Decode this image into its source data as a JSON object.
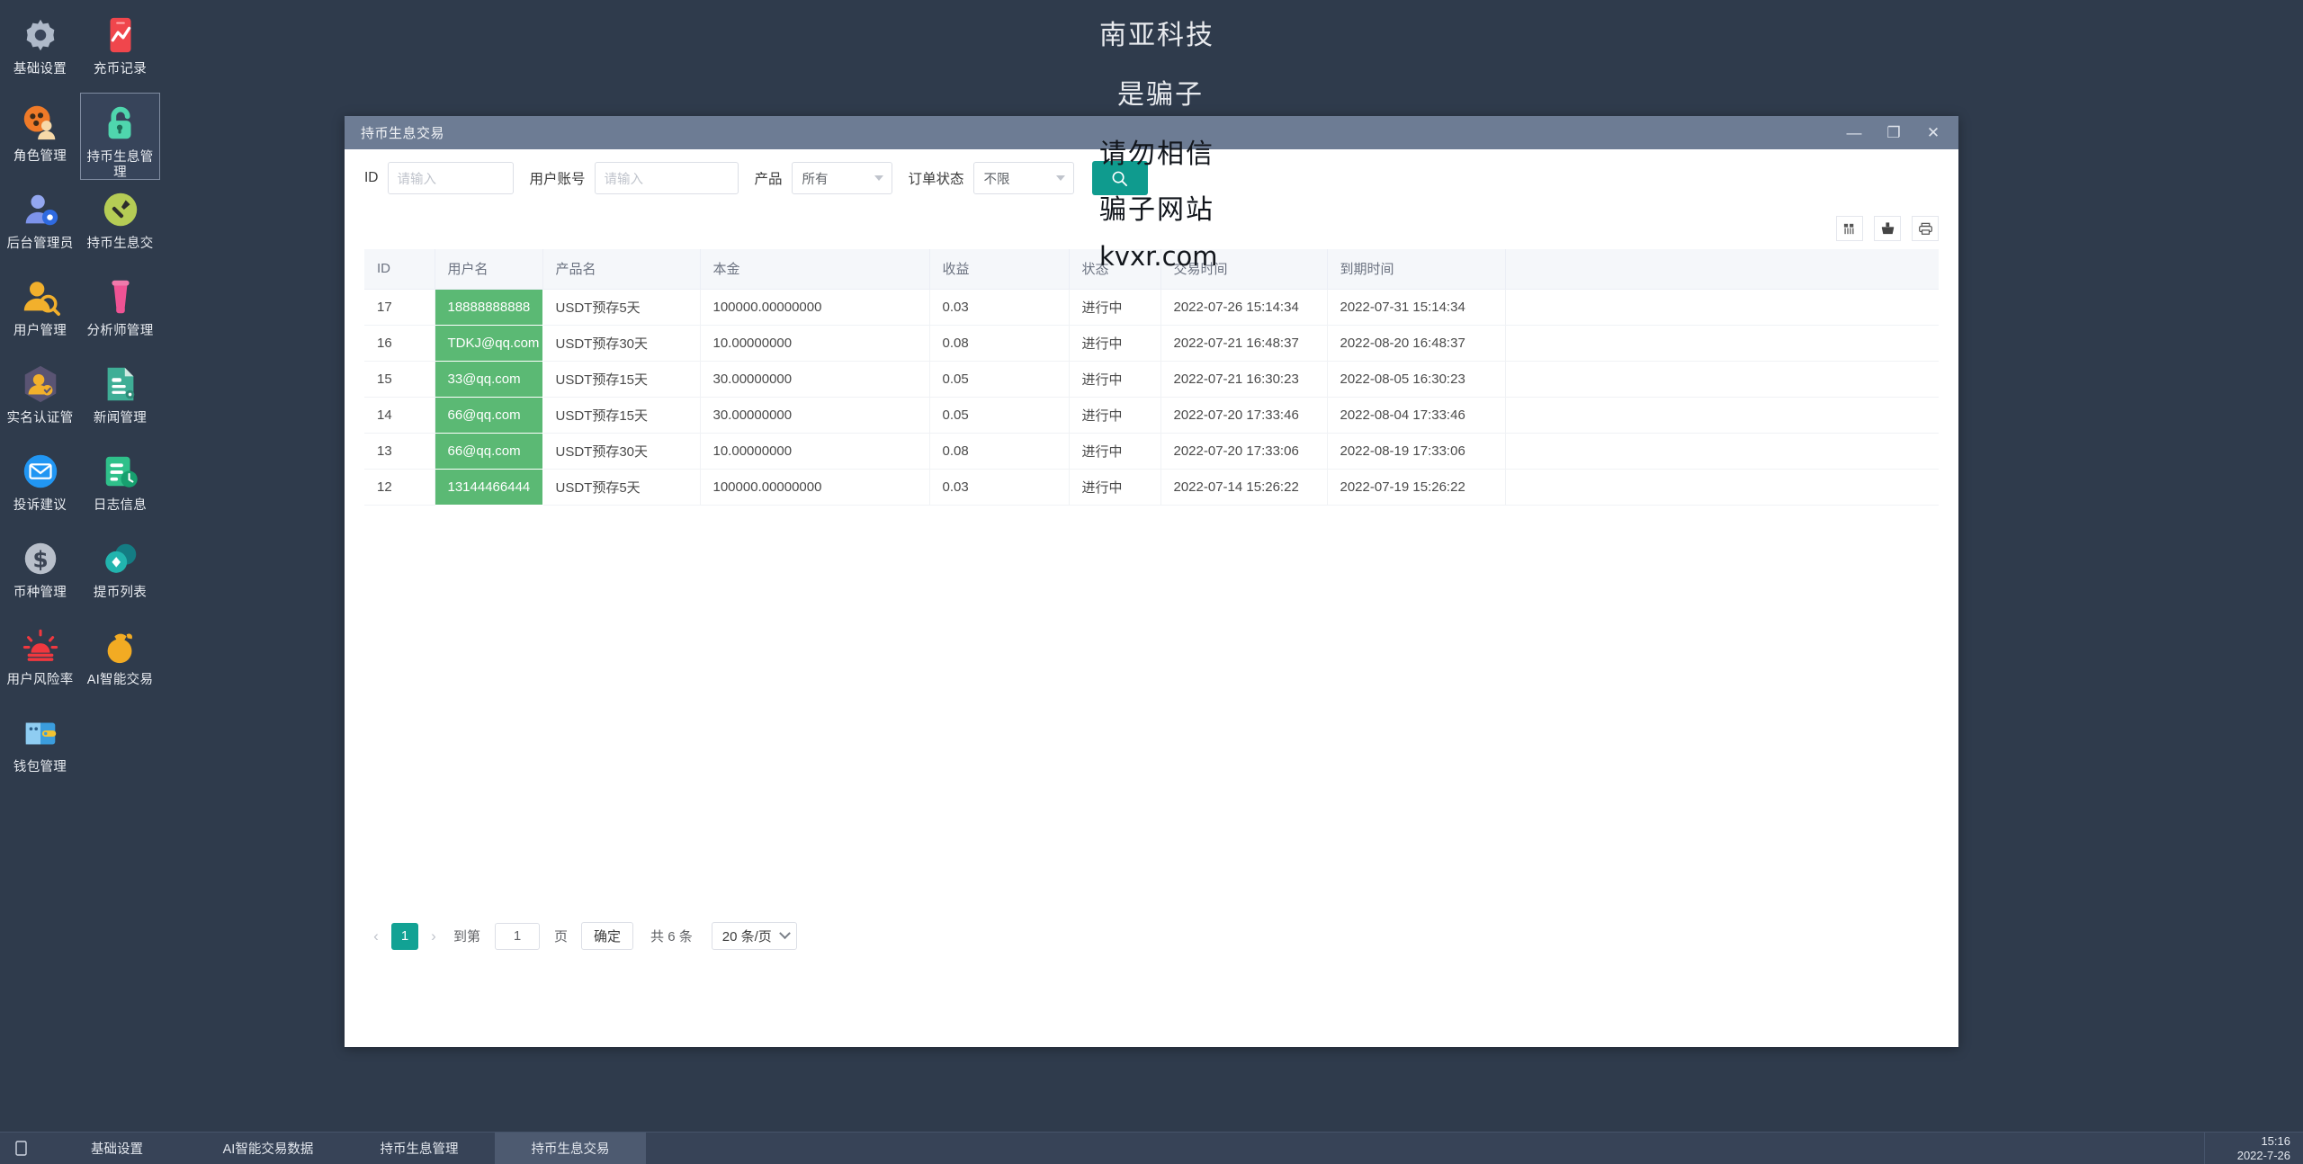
{
  "sidebar": {
    "items": [
      {
        "label": "基础设置",
        "icon": "gear-icon",
        "selected": false
      },
      {
        "label": "充币记录",
        "icon": "chart-card-icon",
        "selected": false
      },
      {
        "label": "角色管理",
        "icon": "role-user-icon",
        "selected": false
      },
      {
        "label": "持币生息管理",
        "icon": "lock-open-icon",
        "selected": true
      },
      {
        "label": "后台管理员",
        "icon": "user-gear-icon",
        "selected": false
      },
      {
        "label": "持币生息交",
        "icon": "hammer-icon",
        "selected": false
      },
      {
        "label": "用户管理",
        "icon": "user-search-icon",
        "selected": false
      },
      {
        "label": "分析师管理",
        "icon": "megaphone-icon",
        "selected": false
      },
      {
        "label": "实名认证管",
        "icon": "verified-user-icon",
        "selected": false
      },
      {
        "label": "新闻管理",
        "icon": "document-gear-icon",
        "selected": false
      },
      {
        "label": "投诉建议",
        "icon": "mail-icon",
        "selected": false
      },
      {
        "label": "日志信息",
        "icon": "log-clock-icon",
        "selected": false
      },
      {
        "label": "币种管理",
        "icon": "dollar-coin-icon",
        "selected": false
      },
      {
        "label": "提币列表",
        "icon": "coins-icon",
        "selected": false
      },
      {
        "label": "用户风险率",
        "icon": "alarm-icon",
        "selected": false
      },
      {
        "label": "AI智能交易",
        "icon": "money-bag-icon",
        "selected": false
      },
      {
        "label": "钱包管理",
        "icon": "wallet-icon",
        "selected": false
      }
    ]
  },
  "window": {
    "title": "持币生息交易",
    "minimize_label": "—",
    "maximize_label": "❐",
    "close_label": "✕"
  },
  "search": {
    "id_label": "ID",
    "id_placeholder": "请输入",
    "account_label": "用户账号",
    "account_placeholder": "请输入",
    "product_label": "产品",
    "product_value": "所有",
    "status_label": "订单状态",
    "status_value": "不限",
    "search_icon": "search-icon"
  },
  "table_tools": {
    "columns_icon": "columns-settings-icon",
    "export_icon": "export-icon",
    "print_icon": "print-icon"
  },
  "table": {
    "columns": [
      "ID",
      "用户名",
      "产品名",
      "本金",
      "收益",
      "状态",
      "交易时间",
      "到期时间"
    ],
    "rows": [
      {
        "id": "17",
        "user": "18888888888",
        "product": "USDT预存5天",
        "principal": "100000.00000000",
        "profit": "0.03",
        "status": "进行中",
        "trade_time": "2022-07-26 15:14:34",
        "expire_time": "2022-07-31 15:14:34"
      },
      {
        "id": "16",
        "user": "TDKJ@qq.com",
        "product": "USDT预存30天",
        "principal": "10.00000000",
        "profit": "0.08",
        "status": "进行中",
        "trade_time": "2022-07-21 16:48:37",
        "expire_time": "2022-08-20 16:48:37"
      },
      {
        "id": "15",
        "user": "33@qq.com",
        "product": "USDT预存15天",
        "principal": "30.00000000",
        "profit": "0.05",
        "status": "进行中",
        "trade_time": "2022-07-21 16:30:23",
        "expire_time": "2022-08-05 16:30:23"
      },
      {
        "id": "14",
        "user": "66@qq.com",
        "product": "USDT预存15天",
        "principal": "30.00000000",
        "profit": "0.05",
        "status": "进行中",
        "trade_time": "2022-07-20 17:33:46",
        "expire_time": "2022-08-04 17:33:46"
      },
      {
        "id": "13",
        "user": "66@qq.com",
        "product": "USDT预存30天",
        "principal": "10.00000000",
        "profit": "0.08",
        "status": "进行中",
        "trade_time": "2022-07-20 17:33:06",
        "expire_time": "2022-08-19 17:33:06"
      },
      {
        "id": "12",
        "user": "13144466444",
        "product": "USDT预存5天",
        "principal": "100000.00000000",
        "profit": "0.03",
        "status": "进行中",
        "trade_time": "2022-07-14 15:26:22",
        "expire_time": "2022-07-19 15:26:22"
      }
    ]
  },
  "pagination": {
    "prev": "‹",
    "next": "›",
    "current_page": "1",
    "goto_label": "到第",
    "goto_value": "1",
    "page_unit": "页",
    "confirm": "确定",
    "total": "共 6 条",
    "page_size": "20 条/页"
  },
  "watermark": {
    "line1": "南亚科技",
    "line2": "是骗子",
    "line3": "请勿相信",
    "line4": "骗子网站",
    "line5": "kvxr.com"
  },
  "taskbar": {
    "start_icon": "start-icon",
    "items": [
      {
        "label": "基础设置",
        "active": false
      },
      {
        "label": "AI智能交易数据",
        "active": false
      },
      {
        "label": "持币生息管理",
        "active": false
      },
      {
        "label": "持币生息交易",
        "active": true
      }
    ],
    "time": "15:16",
    "date": "2022-7-26"
  },
  "colors": {
    "accent": "#12a294",
    "user_cell": "#5bb974",
    "desktop": "#2f3b4c",
    "titlebar": "#6d7c94"
  }
}
